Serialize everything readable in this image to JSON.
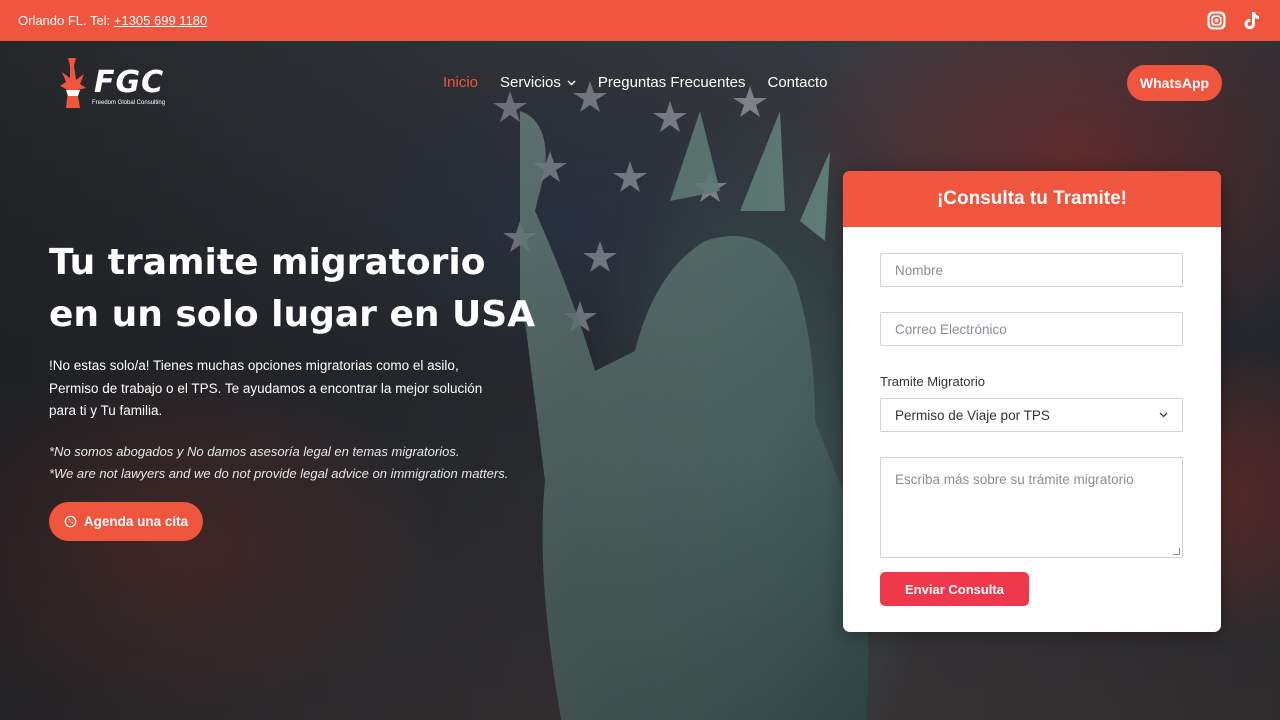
{
  "topbar": {
    "location": "Orlando FL. Tel: ",
    "phone": "+1305 699 1180",
    "social": [
      {
        "icon": "instagram-icon"
      },
      {
        "icon": "tiktok-icon"
      }
    ],
    "bg_color": "#f0553d"
  },
  "logo": {
    "text": "FGC",
    "subtitle": "Freedom Global Consulting"
  },
  "nav": {
    "items": [
      {
        "label": "Inicio",
        "active": true
      },
      {
        "label": "Servicios",
        "has_dropdown": true
      },
      {
        "label": "Preguntas Frecuentes"
      },
      {
        "label": "Contacto"
      }
    ],
    "whatsapp_label": "WhatsApp"
  },
  "hero": {
    "headline_line1": "Tu tramite migratorio",
    "headline_line2": "en un solo lugar en USA",
    "intro_line1": "!No estas solo/a! Tienes muchas opciones migratorias como el asilo,",
    "intro_line2": "Permiso de trabajo o el TPS. Te ayudamos a encontrar la mejor solución",
    "intro_line3": "para ti y Tu familia.",
    "disclaimer_es": "*No somos abogados y No damos asesoría legal en temas migratorios.",
    "disclaimer_en": "*We are not lawyers and we do not provide legal advice on immigration matters.",
    "cta_label": "Agenda una cita"
  },
  "form": {
    "title": "¡Consulta tu Tramite!",
    "name_placeholder": "Nombre",
    "email_placeholder": "Correo Electrónico",
    "select_label": "Tramite Migratorio",
    "select_value": "Permiso de Viaje por TPS",
    "message_placeholder": "Escriba más sobre su trámite migratorio",
    "submit_label": "Enviar Consulta"
  },
  "colors": {
    "accent": "#f0553d",
    "submit": "#f0384d"
  }
}
